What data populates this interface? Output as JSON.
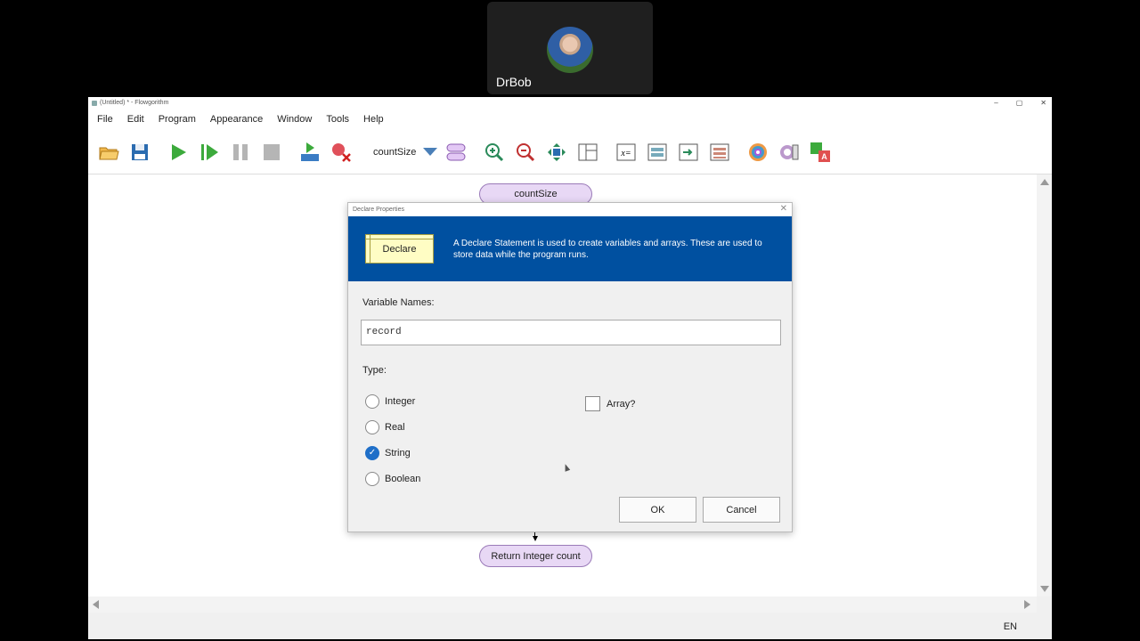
{
  "call": {
    "participant_name": "DrBob"
  },
  "window": {
    "title": "(Untitled) * - Flowgorithm",
    "controls": {
      "minimize": "–",
      "maximize": "▢",
      "close": "✕"
    }
  },
  "menu": [
    "File",
    "Edit",
    "Program",
    "Appearance",
    "Window",
    "Tools",
    "Help"
  ],
  "toolbar": {
    "function_name": "countSize",
    "icons": [
      "open-folder-icon",
      "save-icon",
      "run-icon",
      "step-icon",
      "pause-icon",
      "stop-icon",
      "run-to-icon",
      "clear-breakpoint-icon",
      "function-dropdown-icon",
      "manage-functions-icon",
      "zoom-in-icon",
      "zoom-out-icon",
      "pan-icon",
      "layout-icon",
      "variable-watch-icon",
      "console-icon",
      "output-icon",
      "trace-icon",
      "color-icon",
      "style-icon",
      "translate-icon"
    ]
  },
  "flowchart": {
    "start_label": "countSize",
    "end_label": "Return Integer count"
  },
  "dialog": {
    "title": "Declare Properties",
    "close": "✕",
    "shape_label": "Declare",
    "description": "A Declare Statement is used to create variables and arrays. These are used to store data while the program runs.",
    "variable_names_label": "Variable Names:",
    "variable_names_value": "record",
    "type_label": "Type:",
    "types": [
      "Integer",
      "Real",
      "String",
      "Boolean"
    ],
    "selected_type": "String",
    "array_label": "Array?",
    "array_checked": false,
    "ok_label": "OK",
    "cancel_label": "Cancel"
  },
  "status": {
    "language": "EN"
  },
  "colors": {
    "banner": "#0050a0",
    "terminal_fill": "#e8d8f5",
    "declare_fill": "#fffdc4",
    "radio_selected": "#1f6fc8"
  }
}
